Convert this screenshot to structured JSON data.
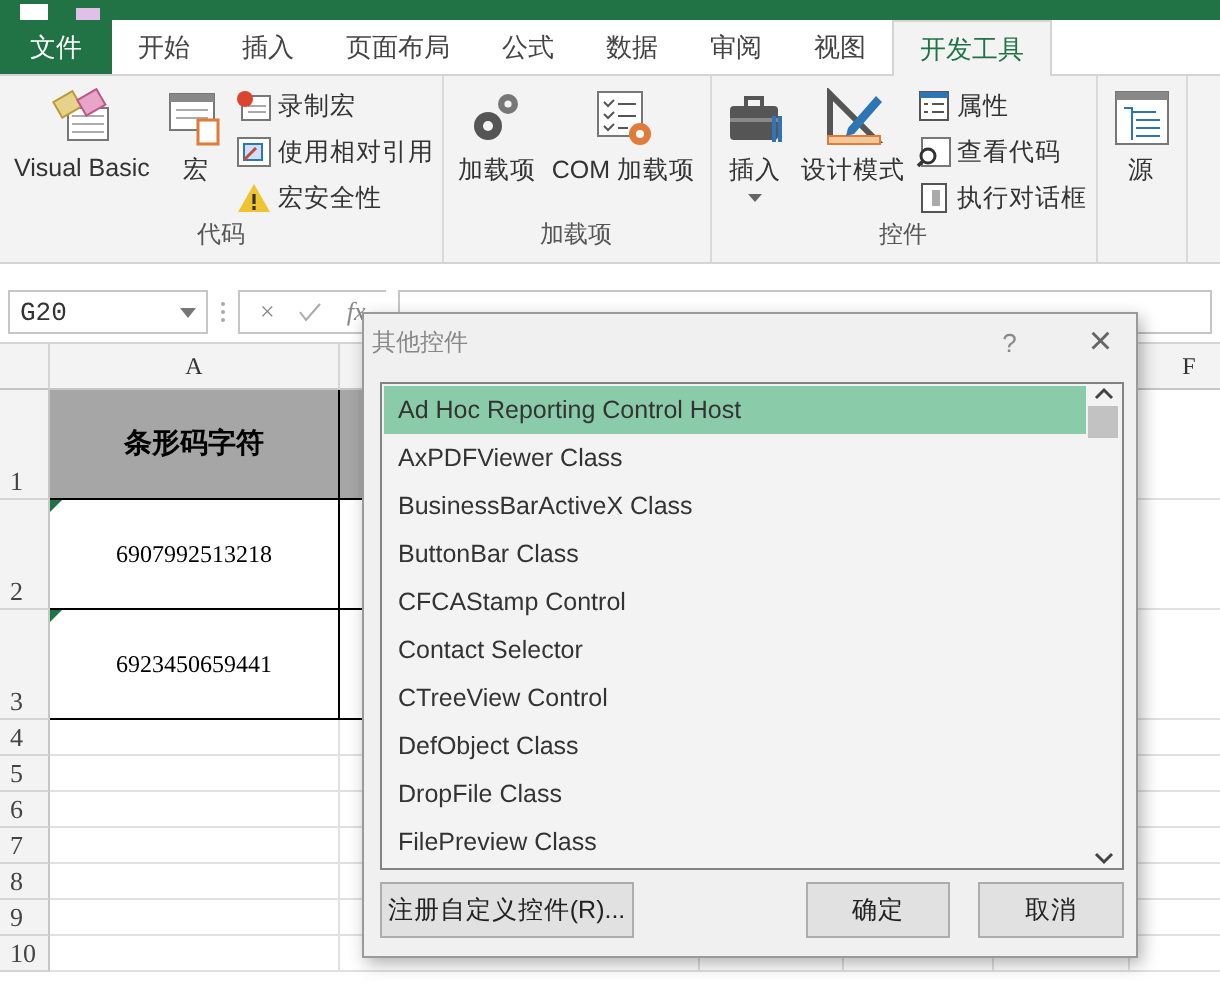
{
  "tabs": [
    {
      "label": "文件",
      "kind": "file",
      "selected": false
    },
    {
      "label": "开始",
      "kind": "normal",
      "selected": false
    },
    {
      "label": "插入",
      "kind": "normal",
      "selected": false
    },
    {
      "label": "页面布局",
      "kind": "normal",
      "selected": false
    },
    {
      "label": "公式",
      "kind": "normal",
      "selected": false
    },
    {
      "label": "数据",
      "kind": "normal",
      "selected": false
    },
    {
      "label": "审阅",
      "kind": "normal",
      "selected": false
    },
    {
      "label": "视图",
      "kind": "normal",
      "selected": false
    },
    {
      "label": "开发工具",
      "kind": "normal",
      "selected": true
    }
  ],
  "ribbon_groups": [
    {
      "label": "代码",
      "large": [
        {
          "label": "Visual Basic",
          "dropdown": false
        },
        {
          "label": "宏",
          "dropdown": false
        }
      ],
      "small": [
        {
          "label": "录制宏"
        },
        {
          "label": "使用相对引用"
        },
        {
          "label": "宏安全性"
        }
      ]
    },
    {
      "label": "加载项",
      "large": [
        {
          "label": "加载项",
          "dropdown": false
        },
        {
          "label": "COM 加载项",
          "dropdown": false
        }
      ]
    },
    {
      "label": "控件",
      "large": [
        {
          "label": "插入",
          "dropdown": true
        },
        {
          "label": "设计模式",
          "dropdown": false
        }
      ],
      "small": [
        {
          "label": "属性"
        },
        {
          "label": "查看代码"
        },
        {
          "label": "执行对话框"
        }
      ]
    },
    {
      "large": [
        {
          "label": "源",
          "dropdown": false
        }
      ]
    }
  ],
  "formula_bar": {
    "name_box": "G20",
    "cancel": "×",
    "function": "fx"
  },
  "sheet": {
    "column_headers": [
      "A",
      "F"
    ],
    "rows": [
      {
        "number": "1",
        "kind": "header",
        "cell": "条形码字符"
      },
      {
        "number": "2",
        "kind": "text-number",
        "cell": "6907992513218"
      },
      {
        "number": "3",
        "kind": "text-number",
        "cell": "6923450659441"
      },
      {
        "number": "4",
        "kind": "empty"
      },
      {
        "number": "5",
        "kind": "empty"
      },
      {
        "number": "6",
        "kind": "empty"
      },
      {
        "number": "7",
        "kind": "empty"
      },
      {
        "number": "8",
        "kind": "empty"
      },
      {
        "number": "9",
        "kind": "empty"
      },
      {
        "number": "10",
        "kind": "empty"
      }
    ]
  },
  "dialog": {
    "title": "其他控件",
    "help": "?",
    "close": "×",
    "items": [
      {
        "label": "Ad Hoc Reporting Control Host",
        "selected": true
      },
      {
        "label": "AxPDFViewer Class",
        "selected": false
      },
      {
        "label": "BusinessBarActiveX Class",
        "selected": false
      },
      {
        "label": "ButtonBar Class",
        "selected": false
      },
      {
        "label": "CFCAStamp Control",
        "selected": false
      },
      {
        "label": "Contact Selector",
        "selected": false
      },
      {
        "label": "CTreeView Control",
        "selected": false
      },
      {
        "label": "DefObject Class",
        "selected": false
      },
      {
        "label": "DropFile Class",
        "selected": false
      },
      {
        "label": "FilePreview Class",
        "selected": false
      }
    ],
    "register_button": "注册自定义控件(R)...",
    "ok_button": "确定",
    "cancel_button": "取消"
  }
}
